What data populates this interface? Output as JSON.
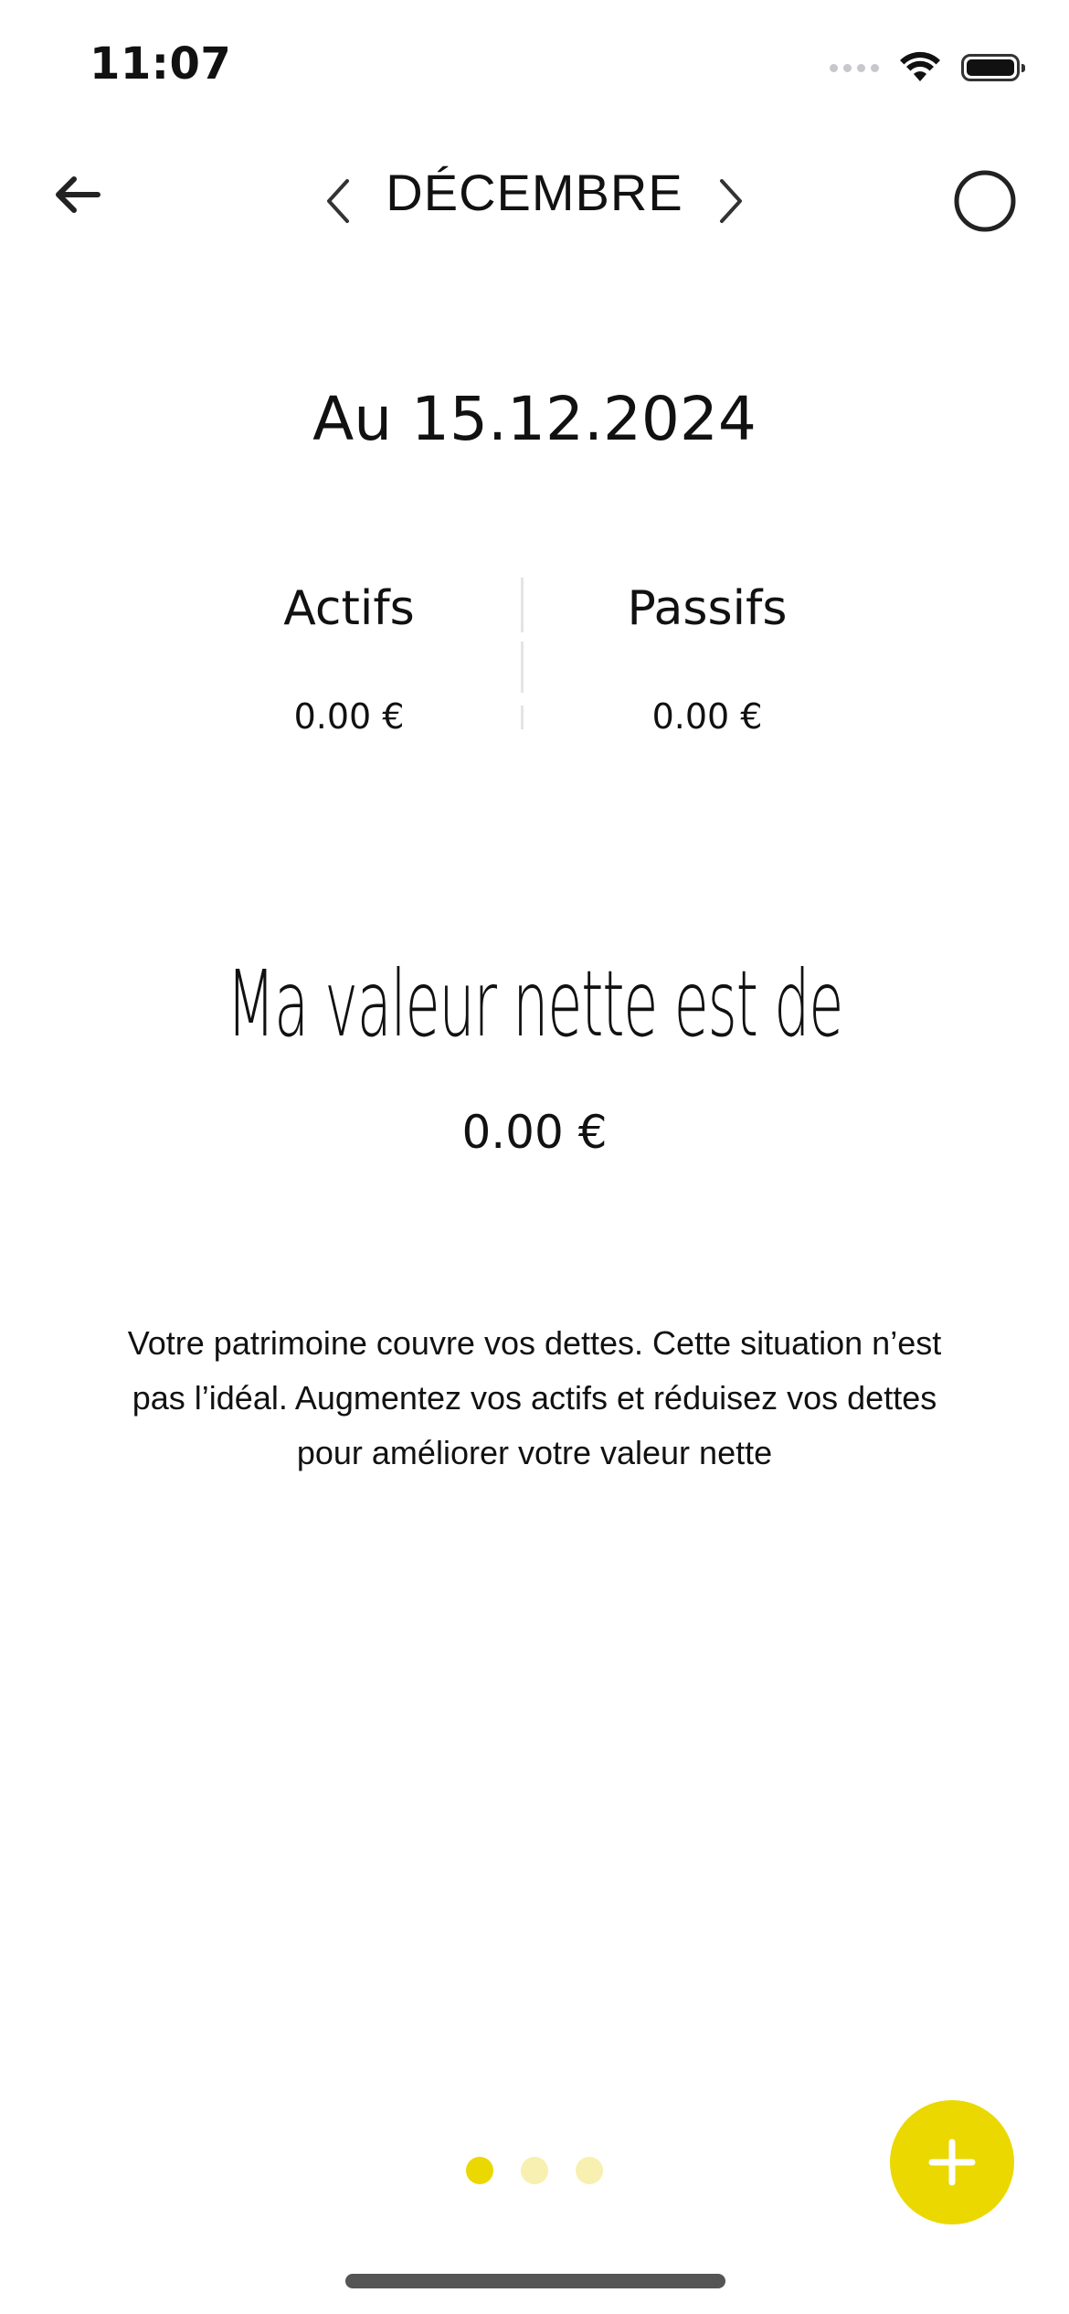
{
  "status_bar": {
    "time": "11:07",
    "icons": [
      "cellular-signal-icon",
      "wifi-icon",
      "battery-icon"
    ]
  },
  "header": {
    "month": "DÉCEMBRE",
    "icons": [
      "back-arrow-icon",
      "chevron-left-icon",
      "chevron-right-icon",
      "circle-icon"
    ]
  },
  "date_heading": "Au 15.12.2024",
  "summary": {
    "assets_label": "Actifs",
    "assets_value": "0.00 €",
    "liabilities_label": "Passifs",
    "liabilities_value": "0.00 €"
  },
  "net_worth": {
    "heading": "Ma valeur nette est de",
    "value": "0.00 €"
  },
  "message": "Votre patrimoine couvre vos dettes. Cette situation n’est pas l’idéal. Augmentez vos actifs et réduisez vos dettes pour améliorer votre valeur nette",
  "pager": {
    "count": 3,
    "active_index": 0
  },
  "fab": {
    "icon": "plus-icon"
  },
  "colors": {
    "accent": "#EAD800",
    "dot_inactive": "#F7F0B0",
    "text": "#111111",
    "divider": "#E4E4E4"
  }
}
